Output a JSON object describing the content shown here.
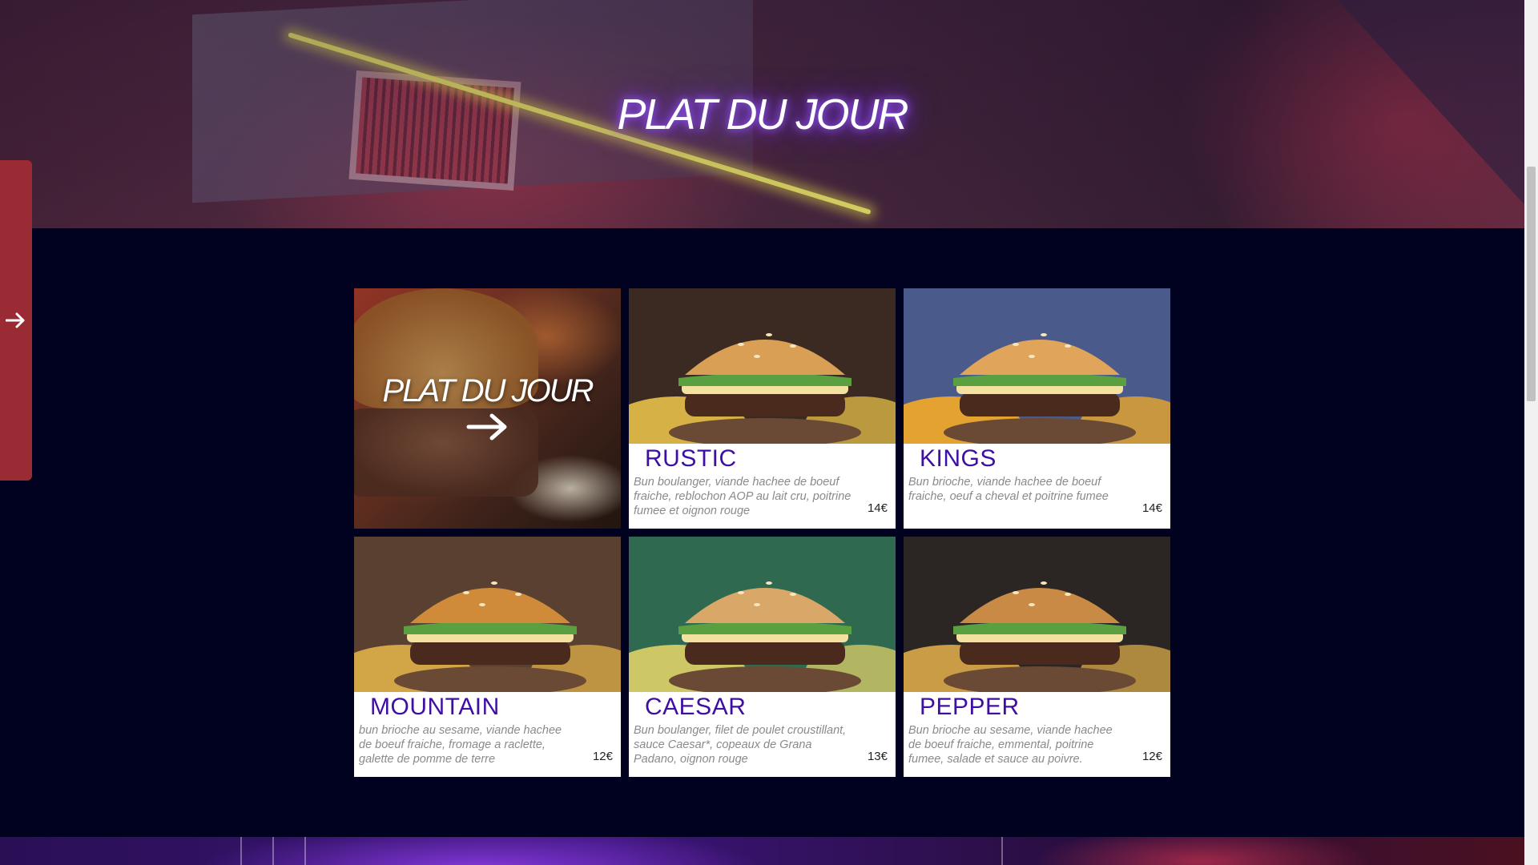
{
  "hero": {
    "title": "PLAT DU JOUR"
  },
  "side_tab": {
    "icon": "arrow-right-icon"
  },
  "feature": {
    "title": "PLAT DU JOUR",
    "icon": "arrow-right-icon"
  },
  "menu": [
    {
      "name": "RUSTIC",
      "description": "Bun boulanger, viande hachee de boeuf fraiche, reblochon AOP au lait cru, poitrine fumee et oignon rouge",
      "price": "14€",
      "photo": {
        "bg": "#3a2a22",
        "bun": "#d9a055",
        "accent": "#f2c94c"
      }
    },
    {
      "name": "KINGS",
      "description": "Bun brioche, viande hachee de boeuf fraiche, oeuf a cheval et poitrine fumee",
      "price": "14€",
      "photo": {
        "bg": "#4a5a8a",
        "bun": "#e0a45a",
        "accent": "#ffb020"
      }
    },
    {
      "name": "MOUNTAIN",
      "description": "bun brioche au sesame, viande hachee de boeuf fraiche, fromage a raclette, galette de pomme de terre",
      "price": "12€",
      "photo": {
        "bg": "#5a4030",
        "bun": "#cf8a3a",
        "accent": "#e8b84a"
      }
    },
    {
      "name": "CAESAR",
      "description": "Bun boulanger, filet de poulet croustillant, sauce Caesar*, copeaux de Grana Padano, oignon rouge",
      "price": "13€",
      "photo": {
        "bg": "#2f6a50",
        "bun": "#d9a868",
        "accent": "#e9d76a"
      }
    },
    {
      "name": "PEPPER",
      "description": "Bun brioche au sesame, viande hachee de boeuf fraiche, emmental, poitrine fumee, salade et sauce au poivre.",
      "price": "12€",
      "photo": {
        "bg": "#2b2624",
        "bun": "#c88a44",
        "accent": "#e6b24c"
      }
    }
  ]
}
